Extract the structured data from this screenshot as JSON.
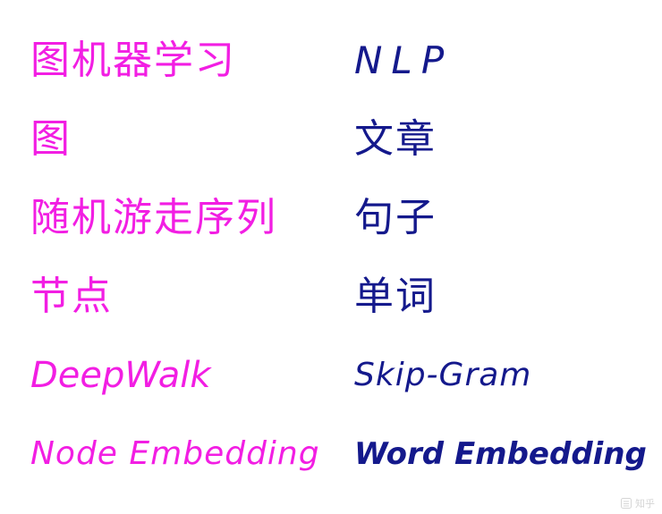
{
  "left_terms": [
    "图机器学习",
    "图",
    "随机游走序列",
    "节点",
    "DeepWalk",
    "Node Embedding"
  ],
  "right_terms": [
    "NLP",
    "文章",
    "句子",
    "单词",
    "Skip-Gram",
    "Word Embedding"
  ],
  "colors": {
    "left_ink": "#f21ee3",
    "right_ink": "#14198c"
  },
  "watermark": {
    "text": "知乎",
    "icon": "zhihu-logo-icon"
  }
}
